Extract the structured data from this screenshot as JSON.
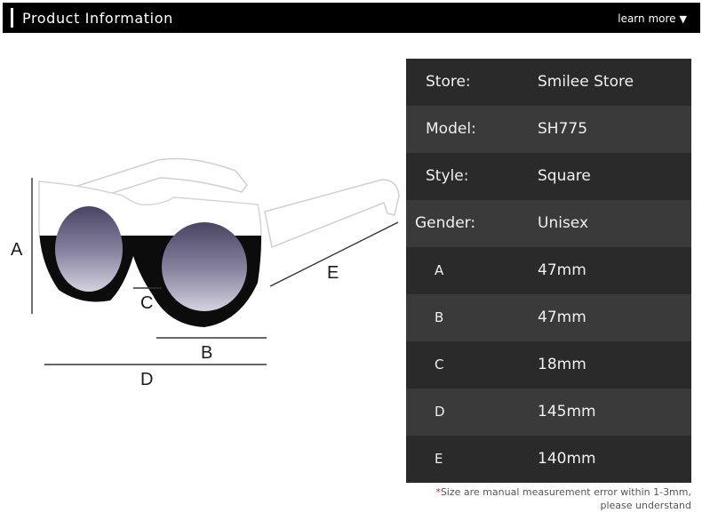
{
  "header": {
    "title": "Product Information",
    "learn_more": "learn more"
  },
  "illustration": {
    "labels": {
      "a": "A",
      "b": "B",
      "c": "C",
      "d": "D",
      "e": "E"
    }
  },
  "specs": [
    {
      "key": "Store:",
      "value": "Smilee Store"
    },
    {
      "key": "Model:",
      "value": "SH775"
    },
    {
      "key": "Style:",
      "value": "Square"
    },
    {
      "key": "Gender:",
      "value": "Unisex"
    },
    {
      "key": "A",
      "value": "47mm"
    },
    {
      "key": "B",
      "value": "47mm"
    },
    {
      "key": "C",
      "value": "18mm"
    },
    {
      "key": "D",
      "value": "145mm"
    },
    {
      "key": "E",
      "value": "140mm"
    }
  ],
  "note": {
    "star": "*",
    "line1": "Size are manual measurement error within 1-3mm,",
    "line2": "please understand"
  }
}
